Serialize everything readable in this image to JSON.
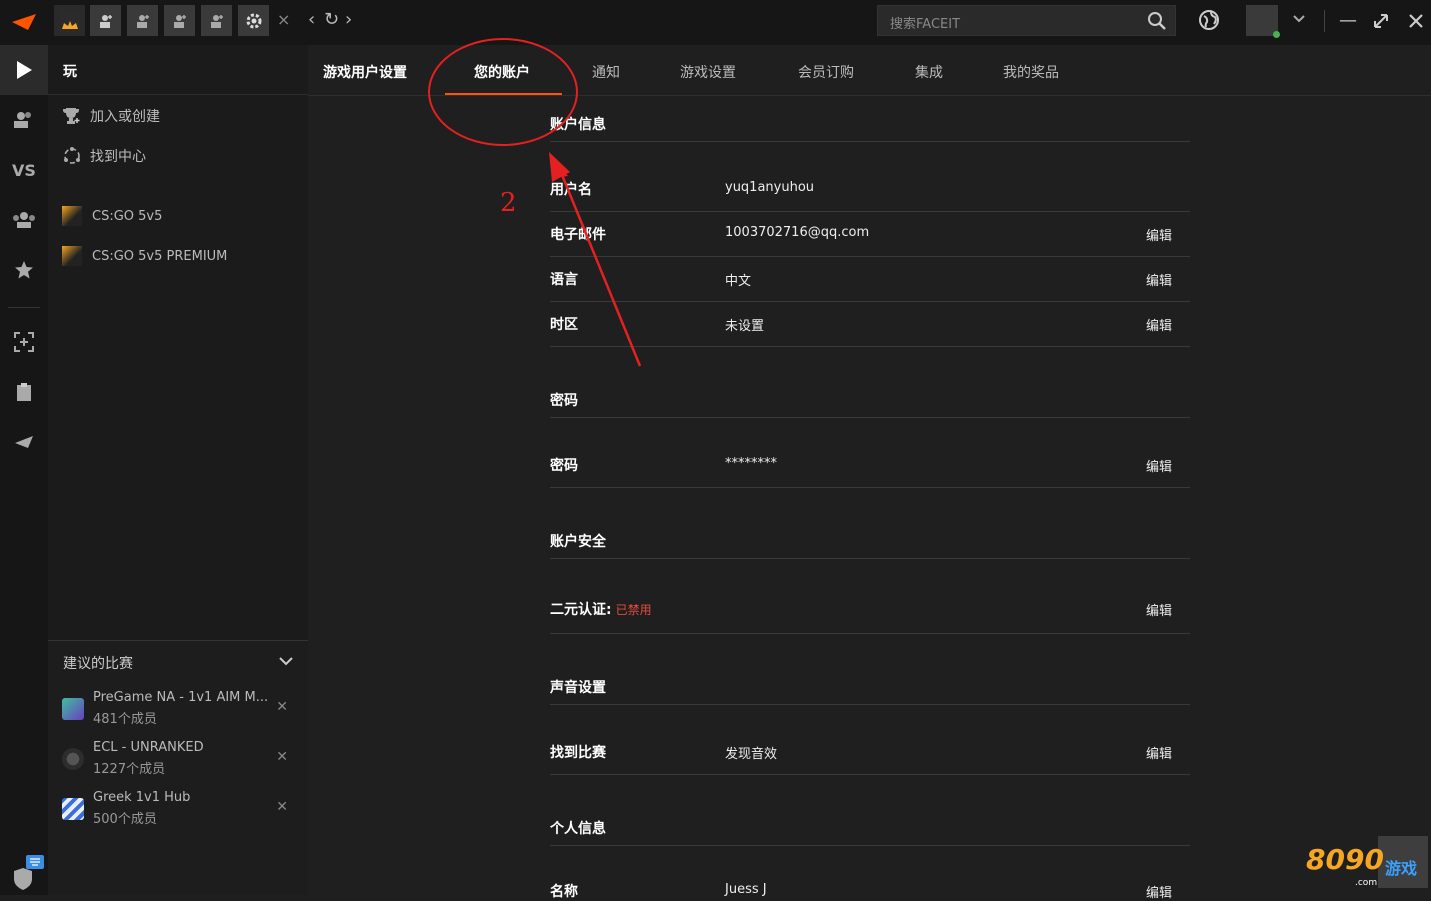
{
  "titlebar": {
    "search_placeholder": "搜索FACEIT",
    "close_tabs": "×"
  },
  "play_panel": {
    "title": "玩",
    "join_create": "加入或创建",
    "find_hub": "找到中心",
    "games": [
      "CS:GO 5v5",
      "CS:GO 5v5 PREMIUM"
    ]
  },
  "suggested": {
    "title": "建议的比赛",
    "items": [
      {
        "name": "PreGame NA - 1v1 AIM M...",
        "members": "481个成员"
      },
      {
        "name": "ECL - UNRANKED",
        "members": "1227个成员"
      },
      {
        "name": "Greek 1v1 Hub",
        "members": "500个成员"
      }
    ]
  },
  "tabs": [
    "游戏用户设置",
    "您的账户",
    "通知",
    "游戏设置",
    "会员订购",
    "集成",
    "我的奖品"
  ],
  "account": {
    "info_title": "账户信息",
    "username_label": "用户名",
    "username_value": "yuq1anyuhou",
    "email_label": "电子邮件",
    "email_value": "1003702716@qq.com",
    "language_label": "语言",
    "language_value": "中文",
    "timezone_label": "时区",
    "timezone_value": "未设置",
    "password_title": "密码",
    "password_label": "密码",
    "password_value": "********",
    "security_title": "账户安全",
    "twofa_label": "二元认证:",
    "twofa_status": "已禁用",
    "sound_title": "声音设置",
    "match_found_label": "找到比赛",
    "match_found_value": "发现音效",
    "personal_title": "个人信息",
    "name_label": "名称",
    "name_value": "Juess J",
    "edit_label": "编辑"
  },
  "annotation": {
    "number": "2",
    "color": "#e52020"
  },
  "watermark": {
    "brand": "8090",
    "cn": "游戏",
    "com": ".com"
  },
  "colors": {
    "accent": "#ff5500",
    "disabled": "#e74c3c"
  }
}
